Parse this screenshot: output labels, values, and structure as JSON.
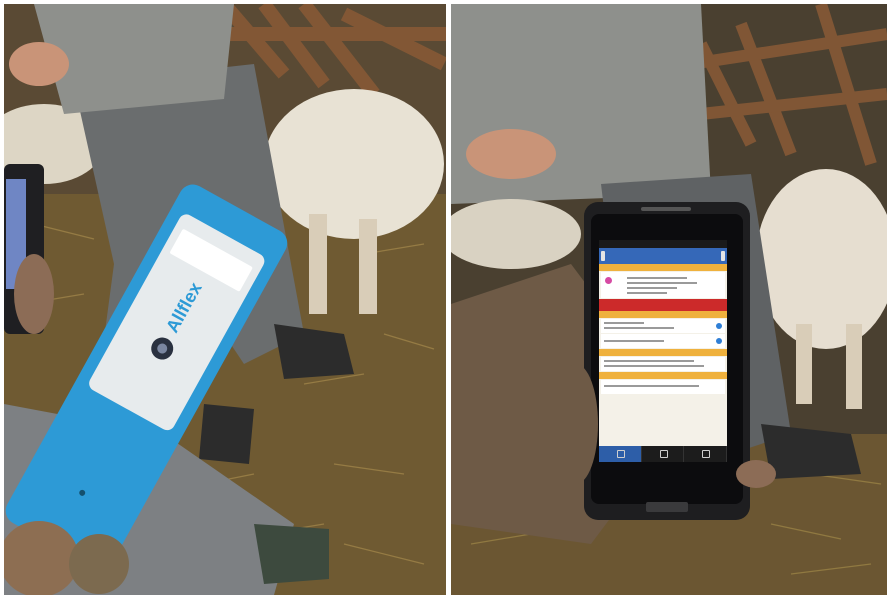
{
  "left_photo": {
    "reader_brand": "Allflex",
    "colors": {
      "reader_body": "#2d9ad6",
      "straw": "#6f5a32",
      "trousers": "#6a6d6e",
      "sheep_wool": "#e8e2d4"
    }
  },
  "right_photo": {
    "colors": {
      "phone_body": "#1e1e20",
      "app_header": "#3568b8",
      "alert_banner": "#cc2a2a",
      "section_band": "#efb13d"
    }
  }
}
